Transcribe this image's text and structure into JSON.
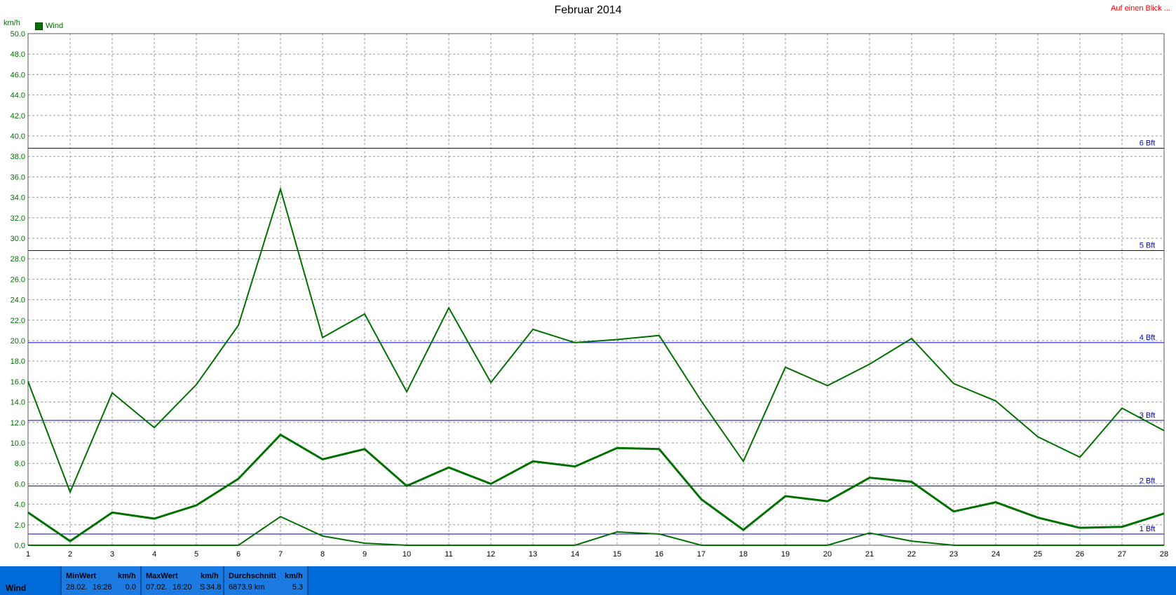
{
  "header": {
    "title": "Februar 2014",
    "link": "Auf einen Blick ...",
    "unit": "km/h",
    "legend": "Wind"
  },
  "colors": {
    "series": "#007000",
    "bft": "#0000cc",
    "footer": "#006ad8"
  },
  "chart_data": {
    "type": "line",
    "title": "Februar 2014",
    "ylabel": "km/h",
    "xlim": [
      1,
      28
    ],
    "ylim": [
      0,
      50
    ],
    "grid": true,
    "legend_position": "top-left",
    "x": [
      1,
      2,
      3,
      4,
      5,
      6,
      7,
      8,
      9,
      10,
      11,
      12,
      13,
      14,
      15,
      16,
      17,
      18,
      19,
      20,
      21,
      22,
      23,
      24,
      25,
      26,
      27,
      28
    ],
    "x_ticks": [
      "1",
      "2",
      "3",
      "4",
      "5",
      "6",
      "7",
      "8",
      "9",
      "10",
      "11",
      "12",
      "13",
      "14",
      "15",
      "16",
      "17",
      "18",
      "19",
      "20",
      "21",
      "22",
      "23",
      "24",
      "25",
      "26",
      "27",
      "28"
    ],
    "y_ticks": [
      "0.0",
      "2.0",
      "4.0",
      "6.0",
      "8.0",
      "10.0",
      "12.0",
      "14.0",
      "16.0",
      "18.0",
      "20.0",
      "22.0",
      "24.0",
      "26.0",
      "28.0",
      "30.0",
      "32.0",
      "34.0",
      "36.0",
      "38.0",
      "40.0",
      "42.0",
      "44.0",
      "46.0",
      "48.0",
      "50.0"
    ],
    "series": [
      {
        "name": "Wind",
        "role": "max",
        "values": [
          16.0,
          5.2,
          14.9,
          11.5,
          15.7,
          21.5,
          34.8,
          20.3,
          22.6,
          15.0,
          23.2,
          15.9,
          21.1,
          19.8,
          20.1,
          20.5,
          14.1,
          8.2,
          17.4,
          15.6,
          17.7,
          20.2,
          15.8,
          14.1,
          10.6,
          8.6,
          13.4,
          11.2
        ]
      },
      {
        "role": "avg",
        "values": [
          3.2,
          0.4,
          3.2,
          2.6,
          3.9,
          6.5,
          10.8,
          8.4,
          9.4,
          5.8,
          7.6,
          6.0,
          8.2,
          7.7,
          9.5,
          9.4,
          4.5,
          1.5,
          4.8,
          4.3,
          6.6,
          6.2,
          3.3,
          4.2,
          2.7,
          1.7,
          1.8,
          3.1
        ]
      },
      {
        "role": "min",
        "values": [
          0,
          0,
          0,
          0,
          0,
          0,
          2.8,
          0.9,
          0.2,
          0,
          0,
          0,
          0,
          0,
          1.3,
          1.1,
          0,
          0,
          0,
          0,
          1.2,
          0.4,
          0,
          0,
          0,
          0,
          0,
          0
        ]
      }
    ],
    "reference_lines": [
      {
        "label": "1 Bft",
        "value": 1.1
      },
      {
        "label": "2 Bft",
        "value": 5.8
      },
      {
        "label": "3 Bft",
        "value": 12.2
      },
      {
        "label": "4 Bft",
        "value": 19.8
      },
      {
        "label": "5 Bft",
        "value": 28.8
      },
      {
        "label": "6 Bft",
        "value": 38.8
      }
    ]
  },
  "footer": {
    "label": "Wind",
    "min": {
      "head": "MinWert",
      "unit": "km/h",
      "date": "28.02.",
      "time": "16:26",
      "value": "0.0"
    },
    "max": {
      "head": "MaxWert",
      "unit": "km/h",
      "date": "07.02.",
      "time": "16:20",
      "dir": "S",
      "value": "34.8"
    },
    "avg": {
      "head": "Durchschnitt",
      "unit": "km/h",
      "distance": "6873.9 km",
      "value": "5.3"
    }
  }
}
